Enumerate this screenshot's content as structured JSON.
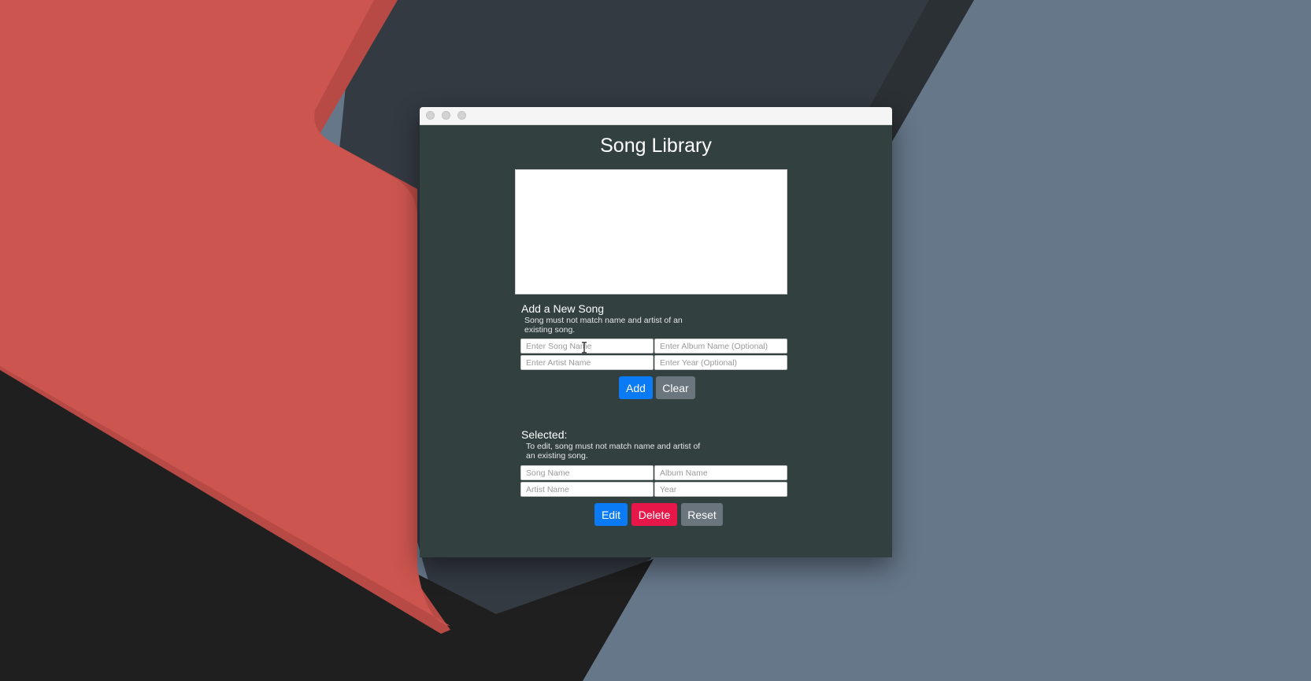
{
  "colors": {
    "window_bg": "#324140",
    "primary": "#0a7bf5",
    "secondary": "#6b757e",
    "danger": "#e8174a",
    "wallpaper_red": "#cc554f",
    "wallpaper_dark": "#343a42",
    "wallpaper_slate": "#66778a",
    "wallpaper_black": "#1f1f1f"
  },
  "app": {
    "title": "Song Library"
  },
  "add_section": {
    "heading": "Add a New Song",
    "hint": "Song must not match name and artist of an\nexisting song.",
    "song_name_placeholder": "Enter Song Name",
    "album_name_placeholder": "Enter Album Name (Optional)",
    "artist_name_placeholder": "Enter Artist Name",
    "year_placeholder": "Enter Year (Optional)",
    "add_label": "Add",
    "clear_label": "Clear"
  },
  "selected_section": {
    "heading": "Selected:",
    "hint": "To edit, song must not match name and artist of\nan existing song.",
    "song_name_placeholder": "Song Name",
    "album_name_placeholder": "Album Name",
    "artist_name_placeholder": "Artist Name",
    "year_placeholder": "Year",
    "edit_label": "Edit",
    "delete_label": "Delete",
    "reset_label": "Reset"
  },
  "icons": {
    "traffic_lights": [
      "close-icon",
      "minimize-icon",
      "zoom-icon"
    ],
    "cursor": "text-cursor-icon"
  }
}
